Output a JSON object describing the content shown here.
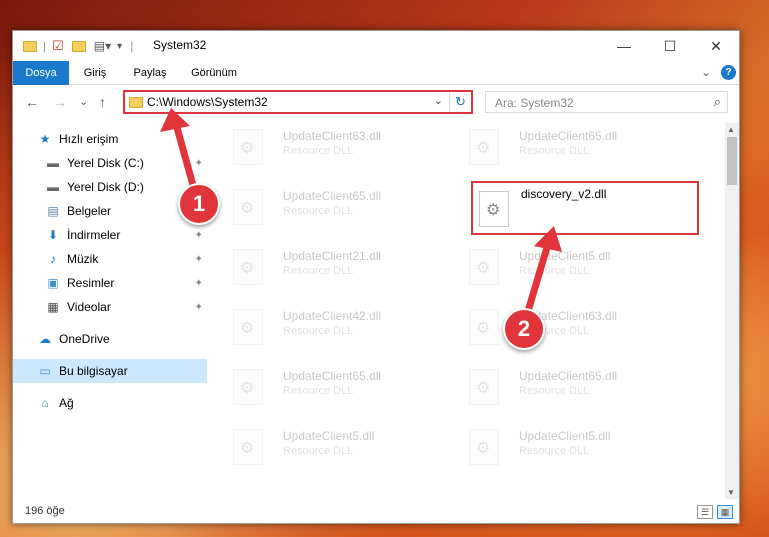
{
  "window": {
    "title": "System32",
    "minimize": "—",
    "maximize": "☐",
    "close": "✕"
  },
  "ribbon": {
    "tabs": [
      "Dosya",
      "Giriş",
      "Paylaş",
      "Görünüm"
    ],
    "active_tab": "Dosya",
    "help": "?",
    "expand": "⌄"
  },
  "navigation": {
    "back": "←",
    "forward": "→",
    "recent": "⌄",
    "up": "↑",
    "address": "C:\\Windows\\System32",
    "address_dropdown": "⌄",
    "refresh": "↻",
    "search_placeholder": "Ara: System32",
    "search_icon": "⌕"
  },
  "sidebar": {
    "items": [
      {
        "label": "Hızlı erişim",
        "icon": "star-icon",
        "glyph": "★",
        "pinned": false
      },
      {
        "label": "Yerel Disk (C:)",
        "icon": "drive-icon",
        "glyph": "▬",
        "pinned": true
      },
      {
        "label": "Yerel Disk (D:)",
        "icon": "drive-icon",
        "glyph": "▬",
        "pinned": true
      },
      {
        "label": "Belgeler",
        "icon": "documents-icon",
        "glyph": "▤",
        "pinned": true
      },
      {
        "label": "İndirmeler",
        "icon": "download-icon",
        "glyph": "⬇",
        "pinned": true
      },
      {
        "label": "Müzik",
        "icon": "music-icon",
        "glyph": "♪",
        "pinned": true
      },
      {
        "label": "Resimler",
        "icon": "pictures-icon",
        "glyph": "▣",
        "pinned": true
      },
      {
        "label": "Videolar",
        "icon": "videos-icon",
        "glyph": "▦",
        "pinned": true
      },
      {
        "label": "OneDrive",
        "icon": "cloud-icon",
        "glyph": "☁",
        "pinned": false
      },
      {
        "label": "Bu bilgisayar",
        "icon": "computer-icon",
        "glyph": "▭",
        "pinned": false,
        "selected": true
      },
      {
        "label": "Ağ",
        "icon": "network-icon",
        "glyph": "⌂",
        "pinned": false
      }
    ],
    "pin_glyph": "📌"
  },
  "files": [
    {
      "name": "UpdateClient63.dll",
      "desc": "Resource DLL",
      "faded": true
    },
    {
      "name": "UpdateClient65.dll",
      "desc": "Resource DLL",
      "faded": true
    },
    {
      "name": "UpdateClient65.dll",
      "desc": "Resource DLL",
      "faded": true
    },
    {
      "name": "discovery_v2.dll",
      "desc": "",
      "faded": false,
      "highlight": true
    },
    {
      "name": "UpdateClient21.dll",
      "desc": "Resource DLL",
      "faded": true
    },
    {
      "name": "UpdateClient5.dll",
      "desc": "Resource DLL",
      "faded": true
    },
    {
      "name": "UpdateClient42.dll",
      "desc": "Resource DLL",
      "faded": true
    },
    {
      "name": "UpdateClient63.dll",
      "desc": "Resource DLL",
      "faded": true
    },
    {
      "name": "UpdateClient65.dll",
      "desc": "Resource DLL",
      "faded": true
    },
    {
      "name": "UpdateClient65.dll",
      "desc": "Resource DLL",
      "faded": true
    },
    {
      "name": "UpdateClient5.dll",
      "desc": "Resource DLL",
      "faded": true
    },
    {
      "name": "UpdateClient5.dll",
      "desc": "Resource DLL",
      "faded": true
    }
  ],
  "status": {
    "count": "196 öğe"
  },
  "annotations": {
    "step1": "1",
    "step2": "2",
    "color": "#e0363b"
  }
}
